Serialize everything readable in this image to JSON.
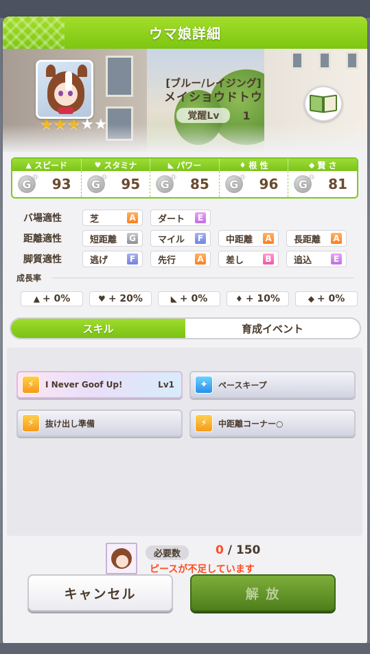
{
  "title": "ウマ娘詳細",
  "character": {
    "epithet": "[ブルー/レイジング]",
    "name": "メイショウドトウ",
    "awaken_label": "覚醒Lv",
    "awaken_level": "1",
    "stars_total": 5,
    "stars_filled": 3,
    "star_filled_glyph": "★",
    "star_empty_glyph": "★"
  },
  "stats": {
    "headers": [
      {
        "label": "スピード",
        "icon": "shoe-icon",
        "glyph": "▲"
      },
      {
        "label": "スタミナ",
        "icon": "heart-icon",
        "glyph": "♥"
      },
      {
        "label": "パワー",
        "icon": "arm-icon",
        "glyph": "◣"
      },
      {
        "label": "根 性",
        "icon": "flame-icon",
        "glyph": "♦"
      },
      {
        "label": "賢 さ",
        "icon": "mortarboard-icon",
        "glyph": "◆"
      }
    ],
    "values": [
      {
        "grade": "G",
        "value": "93"
      },
      {
        "grade": "G",
        "value": "95"
      },
      {
        "grade": "G",
        "value": "85"
      },
      {
        "grade": "G",
        "value": "96"
      },
      {
        "grade": "G",
        "value": "81"
      }
    ],
    "grade_plus": "+"
  },
  "aptitude": {
    "track": {
      "label": "バ場適性",
      "items": [
        {
          "name": "芝",
          "grade": "A"
        },
        {
          "name": "ダート",
          "grade": "E"
        }
      ]
    },
    "distance": {
      "label": "距離適性",
      "items": [
        {
          "name": "短距離",
          "grade": "G"
        },
        {
          "name": "マイル",
          "grade": "F"
        },
        {
          "name": "中距離",
          "grade": "A"
        },
        {
          "name": "長距離",
          "grade": "A"
        }
      ]
    },
    "strategy": {
      "label": "脚質適性",
      "items": [
        {
          "name": "逃げ",
          "grade": "F"
        },
        {
          "name": "先行",
          "grade": "A"
        },
        {
          "name": "差し",
          "grade": "B"
        },
        {
          "name": "追込",
          "grade": "E"
        }
      ]
    }
  },
  "growth": {
    "title": "成長率",
    "items": [
      {
        "icon": "shoe-icon",
        "glyph": "▲",
        "value": "+ 0%"
      },
      {
        "icon": "heart-icon",
        "glyph": "♥",
        "value": "+ 20%"
      },
      {
        "icon": "arm-icon",
        "glyph": "◣",
        "value": "+ 0%"
      },
      {
        "icon": "flame-icon",
        "glyph": "♦",
        "value": "+ 10%"
      },
      {
        "icon": "mortarboard-icon",
        "glyph": "◆",
        "value": "+ 0%"
      }
    ]
  },
  "tabs": {
    "skill": "スキル",
    "event": "育成イベント"
  },
  "skills": [
    {
      "name": "I Never Goof Up!",
      "level": "Lv1",
      "type": "speed",
      "glyph": "⚡"
    },
    {
      "name": "ペースキープ",
      "level": "",
      "type": "stamina",
      "glyph": "✦"
    },
    {
      "name": "抜け出し準備",
      "level": "",
      "type": "speed",
      "glyph": "⚡"
    },
    {
      "name": "中距離コーナー○",
      "level": "",
      "type": "speed",
      "glyph": "⚡"
    }
  ],
  "requirement": {
    "label": "必要数",
    "current": "0",
    "separator": " / ",
    "total": "150",
    "warning": "ピースが不足しています"
  },
  "buttons": {
    "cancel": "キャンセル",
    "release": "解 放"
  },
  "colors": {
    "accent_green": "#7cc611",
    "warning_red": "#ff4a1e",
    "stat_brown": "#6a4a2e"
  }
}
